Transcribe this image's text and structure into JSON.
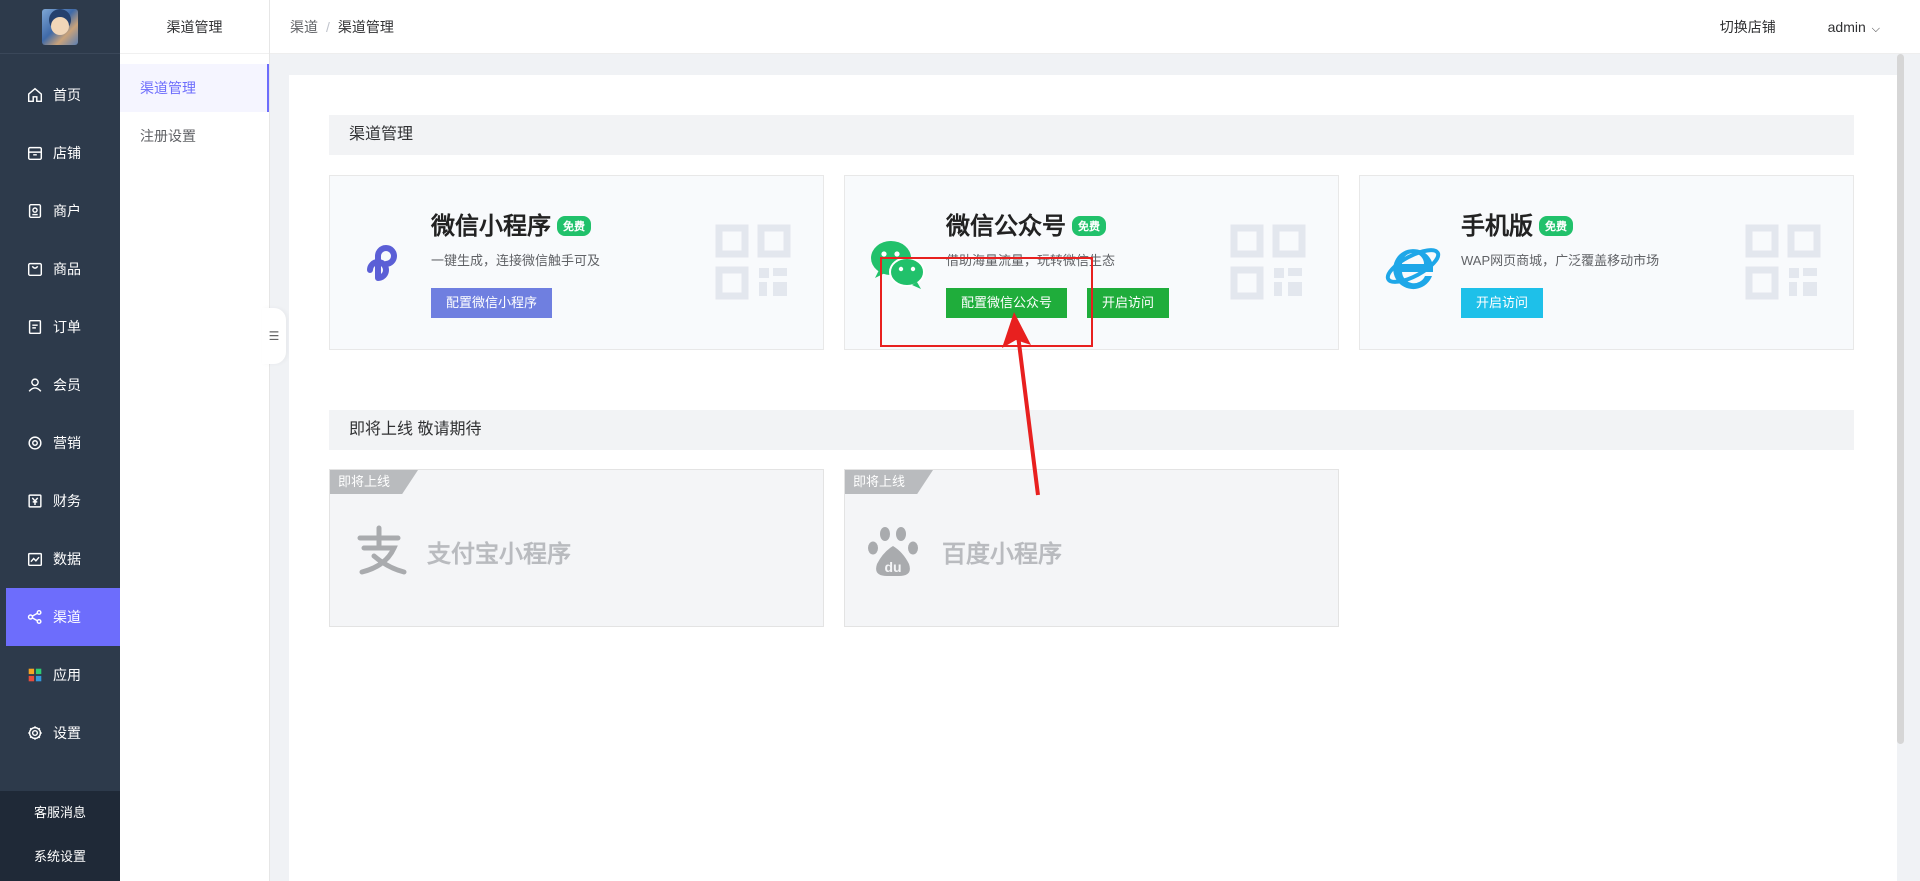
{
  "nav": {
    "items": [
      {
        "label": "首页",
        "icon": "home-icon"
      },
      {
        "label": "店铺",
        "icon": "store-icon"
      },
      {
        "label": "商户",
        "icon": "merchant-icon"
      },
      {
        "label": "商品",
        "icon": "goods-icon"
      },
      {
        "label": "订单",
        "icon": "order-icon"
      },
      {
        "label": "会员",
        "icon": "user-icon"
      },
      {
        "label": "营销",
        "icon": "marketing-icon"
      },
      {
        "label": "财务",
        "icon": "finance-icon"
      },
      {
        "label": "数据",
        "icon": "chart-icon"
      },
      {
        "label": "渠道",
        "icon": "channel-icon"
      },
      {
        "label": "应用",
        "icon": "apps-icon"
      },
      {
        "label": "设置",
        "icon": "gear-icon"
      }
    ],
    "active": "渠道",
    "bottom": [
      "客服消息",
      "系统设置"
    ]
  },
  "submenu": {
    "title": "渠道管理",
    "items": [
      "渠道管理",
      "注册设置"
    ],
    "active": "渠道管理"
  },
  "header": {
    "breadcrumb": [
      "渠道",
      "渠道管理"
    ],
    "switch_store": "切换店铺",
    "user": "admin"
  },
  "sections": {
    "channel_title": "渠道管理",
    "soon_title": "即将上线 敬请期待"
  },
  "channels": [
    {
      "title": "微信小程序",
      "badge": "免费",
      "desc": "一键生成，连接微信触手可及",
      "buttons": [
        "配置微信小程序"
      ],
      "icon": "miniprogram-icon"
    },
    {
      "title": "微信公众号",
      "badge": "免费",
      "desc": "借助海量流量，玩转微信生态",
      "buttons": [
        "配置微信公众号",
        "开启访问"
      ],
      "icon": "wechat-icon"
    },
    {
      "title": "手机版",
      "badge": "免费",
      "desc": "WAP网页商城，广泛覆盖移动市场",
      "buttons": [
        "开启访问"
      ],
      "icon": "mobile-web-icon"
    }
  ],
  "coming_soon": [
    {
      "tag": "即将上线",
      "title": "支付宝小程序",
      "icon": "alipay-icon"
    },
    {
      "tag": "即将上线",
      "title": "百度小程序",
      "icon": "baidu-icon"
    }
  ],
  "colors": {
    "nav_bg": "#2d3a4b",
    "accent": "#6d6dfc",
    "green": "#1fad3b",
    "badge": "#21c16b",
    "cyan": "#1ec0e9",
    "annotation": "#e8201f"
  }
}
